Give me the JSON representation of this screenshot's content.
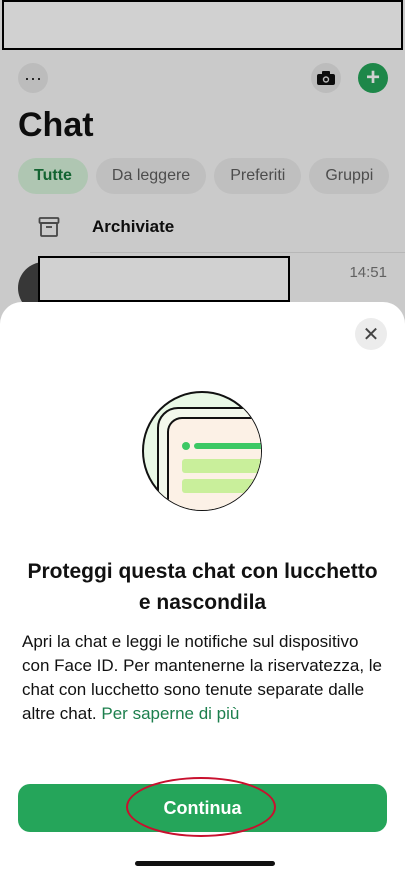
{
  "header": {
    "title": "Chat",
    "more_label": "···",
    "new_chat_label": "+"
  },
  "filters": [
    "Tutte",
    "Da leggere",
    "Preferiti",
    "Gruppi"
  ],
  "archive": {
    "label": "Archiviate"
  },
  "chat_row": {
    "time": "14:51"
  },
  "sheet": {
    "close_label": "✕",
    "title": "Proteggi questa chat con lucchetto e nascondila",
    "body": "Apri la chat e leggi le notifiche sul dispositivo con Face ID. Per mantenerne la riservatezza, le chat con lucchetto sono tenute separate dalle altre chat.",
    "learn_more": "Per saperne di più",
    "continue_label": "Continua"
  },
  "colors": {
    "accent": "#25a55a",
    "link": "#1c7f4d",
    "highlight": "#c8102e"
  }
}
